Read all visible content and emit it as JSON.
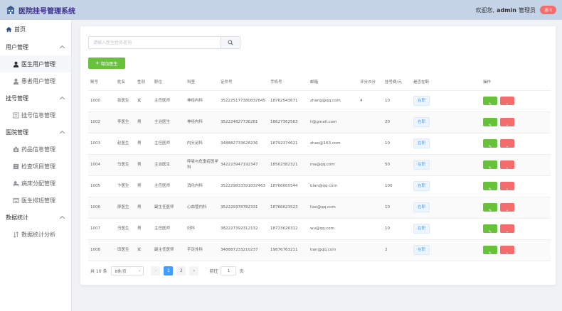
{
  "header": {
    "title": "医院挂号管理系统",
    "welcome": "欢迎您,",
    "username": "admin",
    "role": "管理员",
    "logout_label": "退出"
  },
  "sidebar": {
    "home": "首页",
    "groups": [
      {
        "label": "用户管理",
        "items": [
          {
            "label": "医生用户管理",
            "icon": "user-icon",
            "active": true
          },
          {
            "label": "患者用户管理",
            "icon": "user-icon"
          }
        ]
      },
      {
        "label": "挂号管理",
        "items": [
          {
            "label": "挂号信息管理",
            "icon": "list-icon"
          }
        ]
      },
      {
        "label": "医院管理",
        "items": [
          {
            "label": "药品信息管理",
            "icon": "medicine-icon"
          },
          {
            "label": "检查项目管理",
            "icon": "check-icon"
          },
          {
            "label": "病床分配管理",
            "icon": "bed-icon"
          },
          {
            "label": "医生排班管理",
            "icon": "schedule-icon"
          }
        ]
      },
      {
        "label": "数据统计",
        "items": [
          {
            "label": "数据统计分析",
            "icon": "sort-icon"
          }
        ]
      }
    ]
  },
  "search": {
    "placeholder": "请输入医生姓名查询"
  },
  "toolbar": {
    "add_label": "增加医生"
  },
  "table": {
    "columns": [
      "账号",
      "姓名",
      "性别",
      "职位",
      "科室",
      "证件号",
      "手机号",
      "邮箱",
      "评分/5分",
      "挂号费/元",
      "是否在职",
      "操作"
    ],
    "rows": [
      [
        "1000",
        "张医生",
        "女",
        "主任医师",
        "神经内科",
        "352225177380837645",
        "18762543671",
        "zhang@qq.com",
        "4",
        "10",
        "在职"
      ],
      [
        "1002",
        "李医生",
        "男",
        "主治医生",
        "神经内科",
        "352224827736281",
        "18627362563",
        "li@gmail.com",
        "",
        "20",
        "在职"
      ],
      [
        "1003",
        "赵医生",
        "男",
        "主任医师",
        "内分泌科",
        "348882733628236",
        "18792374621",
        "zhao@163.com",
        "",
        "10",
        "在职"
      ],
      [
        "1004",
        "马医生",
        "男",
        "主治医生",
        "呼吸与危重症医学科",
        "342223947192347",
        "18562382321",
        "ma@qq.com",
        "",
        "50",
        "在职"
      ],
      [
        "1005",
        "卞医生",
        "男",
        "主任医师",
        "消化内科",
        "352229833391837463",
        "18766665544",
        "bian@qq.com",
        "",
        "100",
        "在职"
      ],
      [
        "1006",
        "廖医生",
        "男",
        "副主任医师",
        "心血管内科",
        "352229378782331",
        "18766623523",
        "liao@qq.com",
        "",
        "10",
        "在职"
      ],
      [
        "1007",
        "乌医生",
        "男",
        "主任医师",
        "妇科",
        "382227392312132",
        "18723626312",
        "wu@qq.com",
        "",
        "10",
        "在职"
      ],
      [
        "1008",
        "田医生",
        "女",
        "副主任医师",
        "手足外科",
        "348887233210237",
        "19876763211",
        "tian@qq.com",
        "",
        "2",
        "在职"
      ]
    ]
  },
  "pagination": {
    "total": "共 10 条",
    "page_size": "8条/页",
    "pages": [
      "1",
      "2"
    ],
    "current": "1",
    "goto_label": "前往",
    "goto_value": "1",
    "page_unit": "页"
  }
}
